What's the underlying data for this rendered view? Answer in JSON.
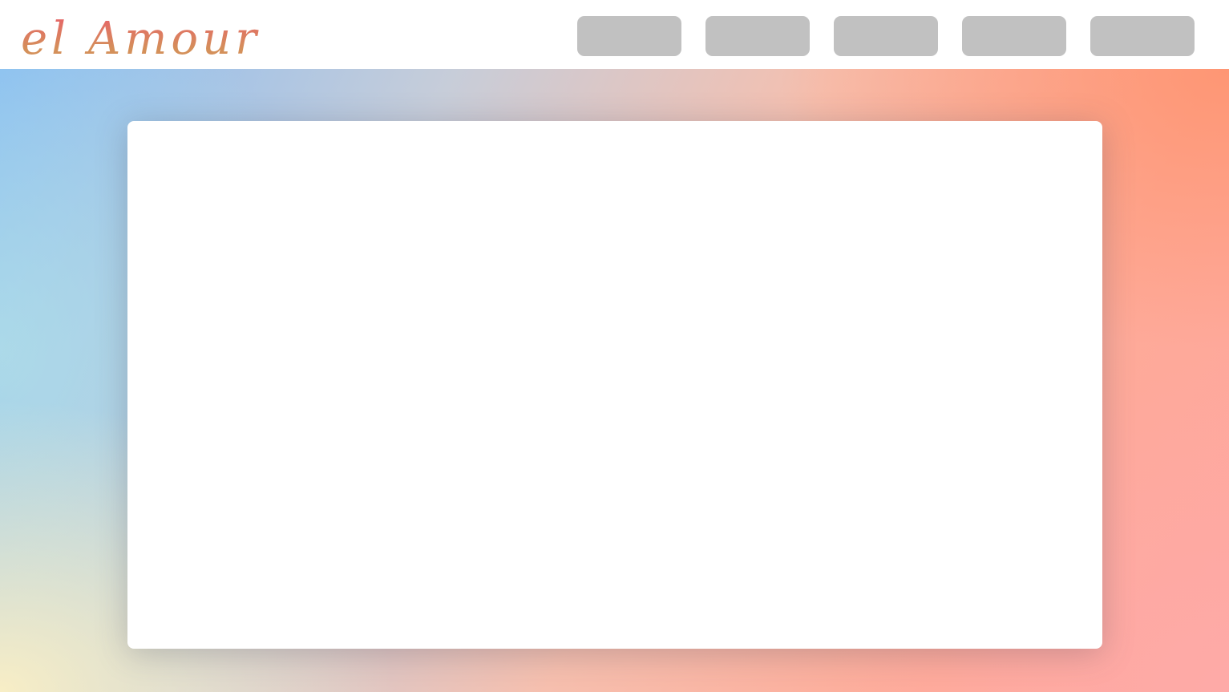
{
  "brand": {
    "logo_text": "el Amour"
  },
  "nav": {
    "items": [
      {
        "label": ""
      },
      {
        "label": ""
      },
      {
        "label": ""
      },
      {
        "label": ""
      },
      {
        "label": ""
      }
    ]
  },
  "colors": {
    "logo_gradient_top": "#e8606a",
    "logo_gradient_bottom": "#d4905a",
    "nav_button": "#c1c1c1",
    "panel": "#ffffff",
    "hero_gradient": [
      "#86bbf2",
      "#b2e2e8",
      "#fcf0c4",
      "#f6bfae",
      "#fe9470",
      "#ffa79e"
    ]
  }
}
